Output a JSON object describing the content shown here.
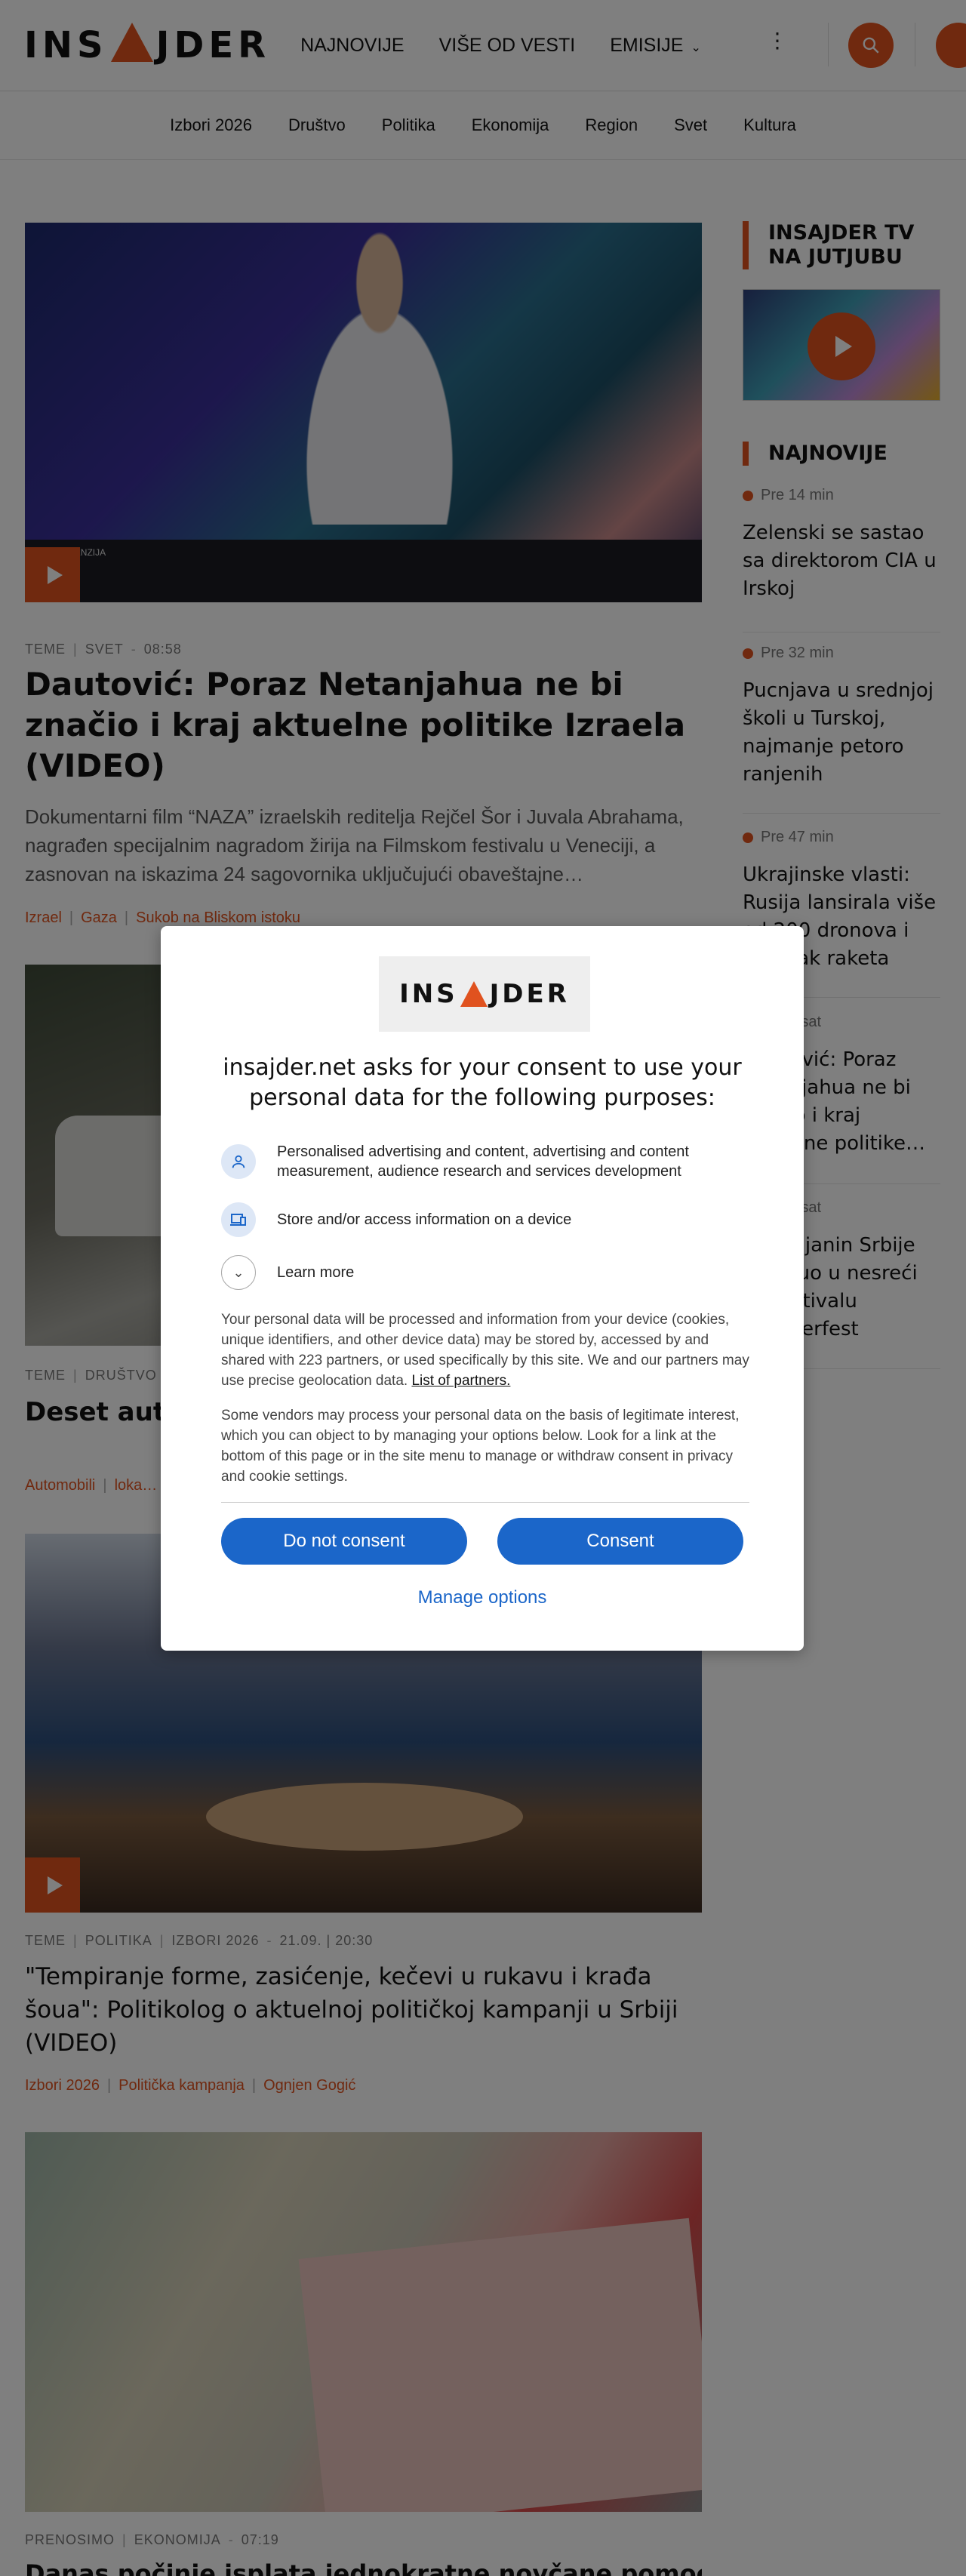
{
  "header": {
    "logo_text_left": "INS",
    "logo_text_right": "JDER",
    "nav": [
      "NAJNOVIJE",
      "VIŠE OD VESTI",
      "EMISIJE"
    ],
    "more_icon": "kebab-icon",
    "search_icon": "search-icon"
  },
  "subnav": [
    "Izbori 2026",
    "Društvo",
    "Politika",
    "Ekonomija",
    "Region",
    "Svet",
    "Kultura"
  ],
  "articles": [
    {
      "meta": [
        "TEME",
        "SVET",
        "08:58"
      ],
      "title": "Dautović: Poraz Netanjahua ne bi značio i kraj aktuelne politike Izraela (VIDEO)",
      "lead": "Dokumentarni film “NAZA” izraelskih reditelja Rejčel Šor i Juvala Abrahama, nagrađen specijalnim nagradom žirija na Filmskom festivalu u Veneciji, a zasnovan na iskazima 24 sagovornika uključujući obaveštajne…",
      "tags": [
        "Izrael",
        "Gaza",
        "Sukob na Bliskom istoku"
      ],
      "image_caption": "NOVA DIMENZIJA"
    },
    {
      "meta": [
        "TEME",
        "DRUŠTVO"
      ],
      "title": "Deset autor… informacija…",
      "tags": [
        "Automobili",
        "loka…"
      ]
    },
    {
      "meta": [
        "TEME",
        "POLITIKA",
        "IZBORI 2026",
        "21.09. | 20:30"
      ],
      "title": "\"Tempiranje forme, zasićenje, kečevi u rukavu i krađa šoua\": Politikolog o aktuelnoj političkoj kampanji u Srbiji (VIDEO)",
      "tags": [
        "Izbori 2026",
        "Politička kampanja",
        "Ognjen Gogić"
      ]
    },
    {
      "meta": [
        "PRENOSIMO",
        "EKONOMIJA",
        "07:19"
      ],
      "title": "Danas počinje isplata jednokratne novčane pomoći od"
    }
  ],
  "sidebar": {
    "tv_heading": "INSAJDER TV NA JUTJUBU",
    "latest_heading": "NAJNOVIJE",
    "items": [
      {
        "time": "Pre 14 min",
        "title": "Zelenski se sastao sa direktorom CIA u Irskoj"
      },
      {
        "time": "Pre 32 min",
        "title": "Pucnjava u srednjoj školi u Turskoj, najmanje petoro ranjenih"
      },
      {
        "time": "Pre 47 min",
        "title": "Ukrajinske vlasti: Rusija lansirala više od 200 dronova i desetak raketa"
      },
      {
        "time": "Pre 1 sat",
        "title": "Dautović: Poraz Netanjahua ne bi značio i kraj aktuelne politike…"
      },
      {
        "time": "Pre 1 sat",
        "title": "Državljanin Srbije poginuo u nesreći na festivalu Oktoberfest"
      }
    ]
  },
  "consent": {
    "logo_left": "INS",
    "logo_right": "JDER",
    "heading": "insajder.net asks for your consent to use your personal data for the following purposes:",
    "purpose_1": "Personalised advertising and content, advertising and content measurement, audience research and services development",
    "purpose_2": "Store and/or access information on a device",
    "learn_more": "Learn more",
    "text_1": "Your personal data will be processed and information from your device (cookies, unique identifiers, and other device data) may be stored by, accessed by and shared with 223 partners, or used specifically by this site. We and our partners may use precise geolocation data.",
    "partners_link": "List of partners.",
    "text_2": "Some vendors may process your personal data on the basis of legitimate interest, which you can object to by managing your options below. Look for a link at the bottom of this page or in the site menu to manage or withdraw consent in privacy and cookie settings.",
    "btn_reject": "Do not consent",
    "btn_accept": "Consent",
    "manage": "Manage options"
  },
  "colors": {
    "accent": "#e0521f",
    "consent_blue": "#1b66c9"
  }
}
